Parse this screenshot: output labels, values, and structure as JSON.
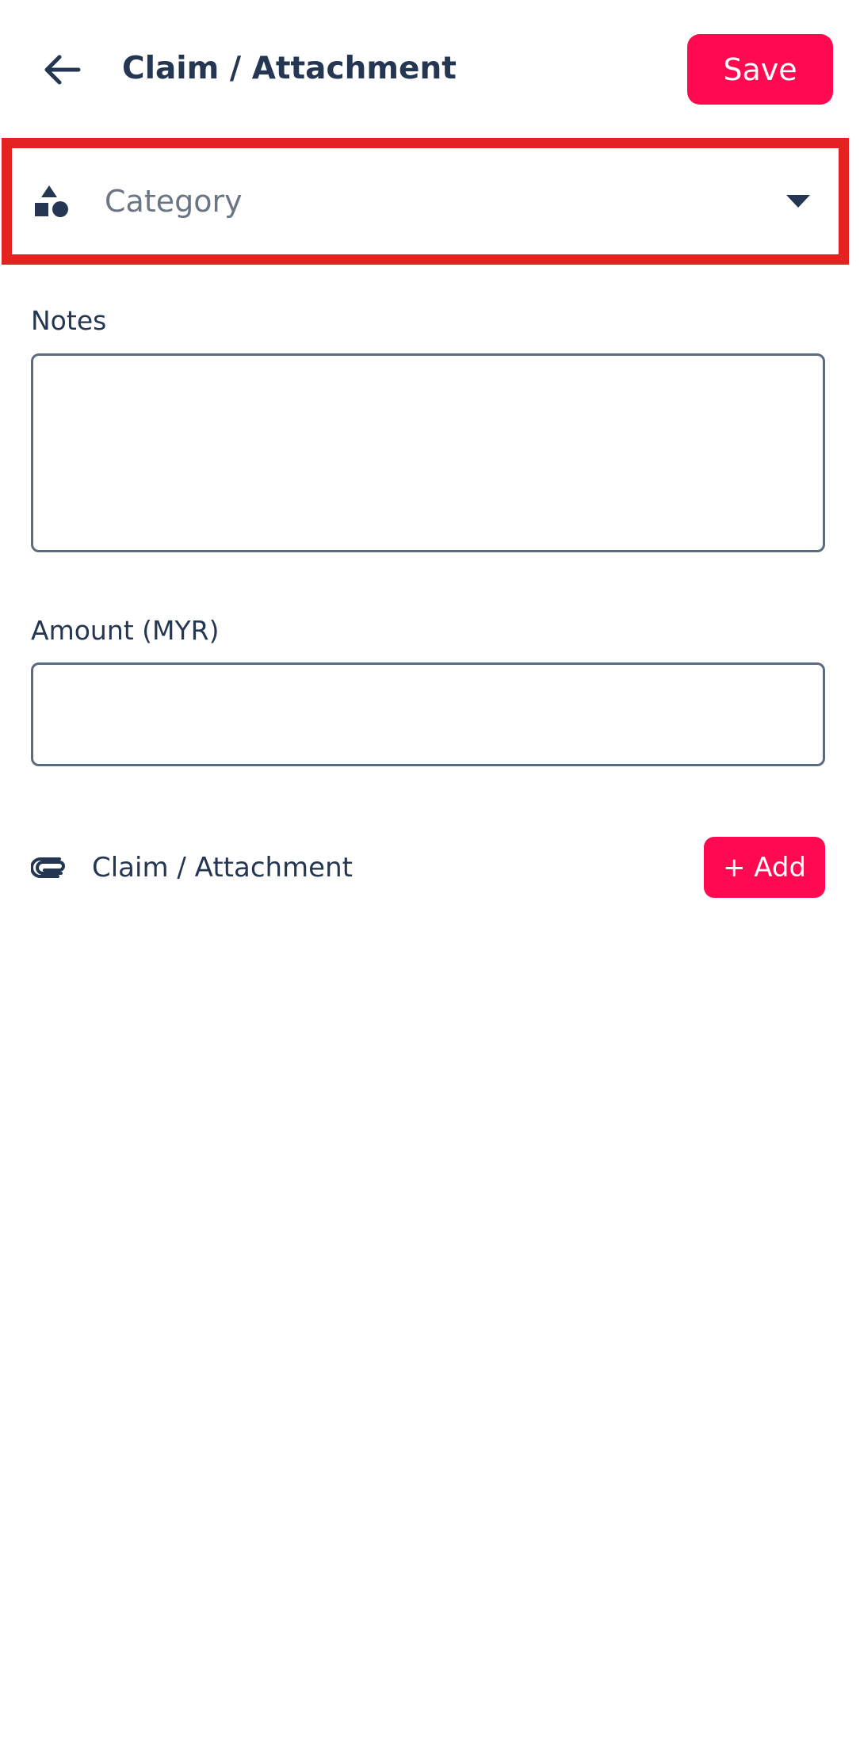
{
  "colors": {
    "accent": "#ff0a50",
    "highlight": "#e52222",
    "text_primary": "#243652",
    "text_placeholder": "#6a7684",
    "input_border": "#5a6b80"
  },
  "header": {
    "back_icon": "arrow-left-icon",
    "title": "Claim / Attachment",
    "save_label": "Save"
  },
  "category": {
    "icon": "shapes-icon",
    "placeholder": "Category",
    "dropdown_icon": "caret-down-icon"
  },
  "notes": {
    "label": "Notes",
    "value": ""
  },
  "amount": {
    "label": "Amount (MYR)",
    "value": ""
  },
  "attachment": {
    "icon": "paperclip-icon",
    "label": "Claim / Attachment",
    "add_label": "+ Add"
  }
}
